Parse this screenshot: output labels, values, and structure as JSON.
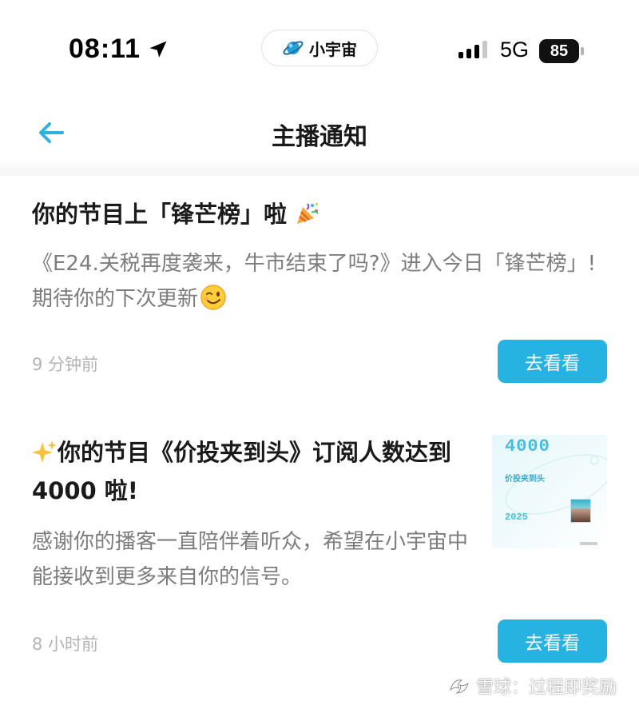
{
  "status_bar": {
    "time": "08:11",
    "app_name": "小宇宙",
    "network": "5G",
    "battery": "85"
  },
  "header": {
    "title": "主播通知"
  },
  "notifications": [
    {
      "title": "你的节目上「锋芒榜」啦",
      "title_icon": "party-popper-icon",
      "body": "《E24.关税再度袭来，牛市结束了吗?》进入今日「锋芒榜」! 期待你的下次更新",
      "body_icon": "winking-face-icon",
      "time": "9 分钟前",
      "button": "去看看"
    },
    {
      "title_icon": "sparkles-icon",
      "title": "你的节目《价投夹到头》订阅人数达到 4000 啦!",
      "body": "感谢你的播客一直陪伴着听众，希望在小宇宙中能接收到更多来自你的信号。",
      "time": "8 小时前",
      "button": "去看看",
      "thumbnail": {
        "count": "4000",
        "show": "价投夹到头",
        "year": "2025"
      }
    }
  ],
  "watermark": "雪球：过程即奖励",
  "colors": {
    "accent": "#26b3e2",
    "body_text": "#7d7d7d",
    "time_text": "#b3b3b3"
  }
}
